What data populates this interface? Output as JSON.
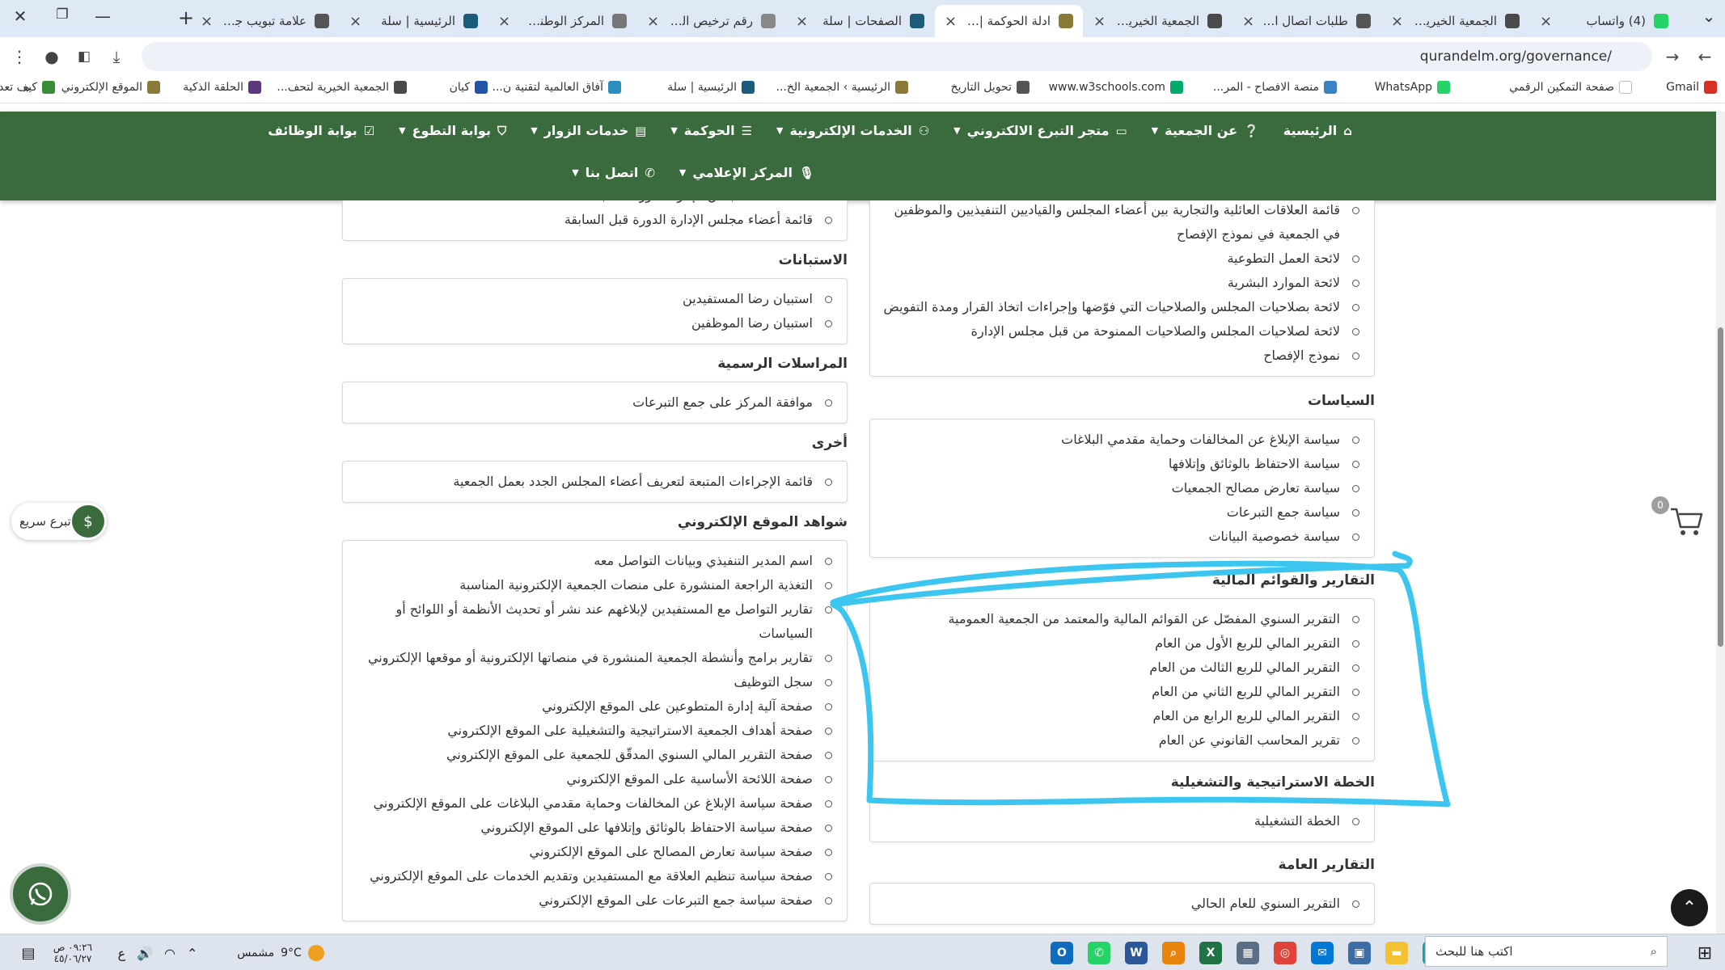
{
  "browser": {
    "tabs": [
      {
        "title": "(4) واتساب",
        "color": "#25d366",
        "active": false
      },
      {
        "title": "الجمعية الخيرية لتح",
        "color": "#4a4a4a",
        "active": false
      },
      {
        "title": "طلبات اتصال الزوا",
        "color": "#555555",
        "active": false
      },
      {
        "title": "الجمعية الخيرية لتح",
        "color": "#4a4a4a",
        "active": false
      },
      {
        "title": "ادلة الحوكمة | الجم",
        "color": "#8a7a3a",
        "active": true
      },
      {
        "title": "الصفحات | سلة",
        "color": "#1a5c7a",
        "active": false
      },
      {
        "title": "رقم ترخيص التبرع",
        "color": "#888888",
        "active": false
      },
      {
        "title": "المركز الوطني لتنم",
        "color": "#777777",
        "active": false
      },
      {
        "title": "الرئيسية | سلة",
        "color": "#1a5c7a",
        "active": false
      },
      {
        "title": "علامة تبويب جديدة",
        "color": "#555555",
        "active": false
      }
    ],
    "new_tab": "+",
    "url": "qurandelm.org/governance/",
    "bookmarks": [
      {
        "label": "Gmail",
        "color": "#d93025"
      },
      {
        "label": "صفحة التمكين الرقمي",
        "color": "#ffffff"
      },
      {
        "label": "WhatsApp",
        "color": "#25d366"
      },
      {
        "label": "منصة الافصاح - المر...",
        "color": "#3b82c4"
      },
      {
        "label": "www.w3schools.com",
        "color": "#04aa6d"
      },
      {
        "label": "تحويل التاريخ",
        "color": "#555555"
      },
      {
        "label": "الرئيسية › الجمعية الخ...",
        "color": "#8a7a3a"
      },
      {
        "label": "الرئيسية | سلة",
        "color": "#1a5c7a"
      },
      {
        "label": "آفاق العالمية لتقنية ن...",
        "color": "#2a8fbd"
      },
      {
        "label": "كيان",
        "color": "#2255aa"
      },
      {
        "label": "الجمعية الخيرية لتحف...",
        "color": "#4a4a4a"
      },
      {
        "label": "الحلقة الذكية",
        "color": "#5a3a7a"
      },
      {
        "label": "الموقع الإلكتروني",
        "color": "#8a7a3a"
      },
      {
        "label": "كيف تعد ملف الحوكم...",
        "color": "#3a8a3a"
      }
    ]
  },
  "nav": {
    "row1": [
      {
        "label": "الرئيسية",
        "icon": "⌂",
        "caret": false
      },
      {
        "label": "عن الجمعية",
        "icon": "❔",
        "caret": true
      },
      {
        "label": "متجر التبرع الالكتروني",
        "icon": "▭",
        "caret": true
      },
      {
        "label": "الخدمات الإلكترونية",
        "icon": "⚇",
        "caret": true
      },
      {
        "label": "الحوكمة",
        "icon": "☰",
        "caret": true
      },
      {
        "label": "خدمات الزوار",
        "icon": "▤",
        "caret": true
      },
      {
        "label": "بوابة التطوع",
        "icon": "⛉",
        "caret": true
      },
      {
        "label": "بوابة الوظائف",
        "icon": "☑",
        "caret": false
      }
    ],
    "row2": [
      {
        "label": "المركز الإعلامي",
        "icon": "🎙",
        "caret": true
      },
      {
        "label": "اتصل بنا",
        "icon": "✆",
        "caret": true
      }
    ]
  },
  "right_col": {
    "top_box_items": [
      "قائمة العلاقات العائلية والتجارية بين أعضاء المجلس والقياديين التنفيذيين والموظفين في الجمعية في نموذج الإفصاح",
      "لائحة العمل التطوعية",
      "لائحة الموارد البشرية",
      "لائحة بصلاحيات المجلس والصلاحيات التي فوّضها وإجراءات اتخاذ القرار ومدة التفويض",
      "لائحة لصلاحيات المجلس والصلاحيات الممنوحة من قبل مجلس الإدارة",
      "نموذج الإفصاح"
    ],
    "policies_title": "السياسات",
    "policies": [
      "سياسة الإبلاغ عن المخالفات وحماية مقدمي البلاغات",
      "سياسة الاحتفاظ بالوثائق وإتلافها",
      "سياسة تعارض مصالح الجمعيات",
      "سياسة جمع التبرعات",
      "سياسة خصوصية البيانات"
    ],
    "financial_title": "التقارير والقوائم المالية",
    "financial": [
      "التقرير السنوي المفصّل عن القوائم المالية والمعتمد من الجمعية العمومية",
      "التقرير المالي للربع الأول من العام",
      "التقرير المالي للربع الثالث من العام",
      "التقرير المالي للربع الثاني من العام",
      "التقرير المالي للربع الرابع من العام",
      "تقرير المحاسب القانوني عن العام"
    ],
    "operational_title": "الخطة الاستراتيجية والتشغيلية",
    "operational": [
      "الخطة التشغيلية"
    ],
    "general_title": "التقارير العامة",
    "general": [
      "التقرير السنوي للعام الحالي"
    ]
  },
  "left_col": {
    "top_box_items": [
      "قائمة أعضاء مجلس الإدارة الدورة السابقة",
      "قائمة أعضاء مجلس الإدارة الدورة قبل السابقة"
    ],
    "surveys_title": "الاستبانات",
    "surveys": [
      "استبيان رضا المستفيدين",
      "استبيان رضا الموظفين"
    ],
    "correspondence_title": "المراسلات الرسمية",
    "correspondence": [
      "موافقة المركز على جمع التبرعات"
    ],
    "other_title": "أخرى",
    "other": [
      "قائمة الإجراءات المتبعة لتعريف أعضاء المجلس الجدد بعمل الجمعية"
    ],
    "evidence_title": "شواهد الموقع الإلكتروني",
    "evidence": [
      "اسم المدير التنفيذي وبيانات التواصل معه",
      "التغذية الراجعة المنشورة على منصات الجمعية الإلكترونية المناسبة",
      "تقارير التواصل مع المستفيدين لإبلاغهم عند نشر أو تحديث الأنظمة أو اللوائح أو السياسات",
      "تقارير برامج وأنشطة الجمعية المنشورة في منصاتها الإلكترونية أو موقعها الإلكتروني",
      "سجل التوظيف",
      "صفحة آلية إدارة المتطوعين على الموقع الإلكتروني",
      "صفحة أهداف الجمعية الاستراتيجية والتشغيلية على الموقع الإلكتروني",
      "صفحة التقرير المالي السنوي المدقّق للجمعية على الموقع الإلكتروني",
      "صفحة اللائحة الأساسية على الموقع الإلكتروني",
      "صفحة سياسة الإبلاغ عن المخالفات وحماية مقدمي البلاغات على الموقع الإلكتروني",
      "صفحة سياسة الاحتفاظ بالوثائق وإتلافها على الموقع الإلكتروني",
      "صفحة سياسة تعارض المصالح على الموقع الإلكتروني",
      "صفحة سياسة تنظيم العلاقة مع المستفيدين وتقديم الخدمات على الموقع الإلكتروني",
      "صفحة سياسة جمع التبرعات على الموقع الإلكتروني"
    ]
  },
  "widgets": {
    "quick_donate": "تبرع سريع",
    "cart_count": "0"
  },
  "taskbar": {
    "search_placeholder": "اكتب هنا للبحث",
    "weather_label": "مشمس",
    "weather_temp": "9°C",
    "lang": "ع",
    "time": "٠٩:٢٦ ص",
    "date": "٤٥/٠٦/٢٧"
  }
}
